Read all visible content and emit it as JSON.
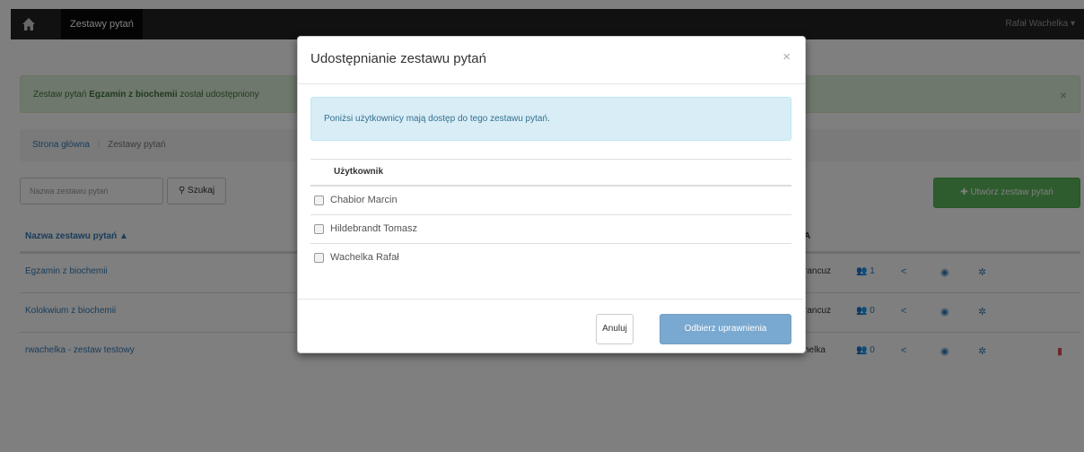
{
  "navbar": {
    "brand": "Zestawy pytań",
    "user": "Rafał Wachelka"
  },
  "alert": {
    "prefix": "Zestaw pytań",
    "name": "Egzamin z biochemii",
    "suffix": "został udostępniony",
    "close": "×"
  },
  "breadcrumb": {
    "home": "Strona główna",
    "current": "Zestawy pytań"
  },
  "search": {
    "placeholder": "Nazwa zestawu pytań",
    "button": "Szukaj"
  },
  "create_button": "Utwórz zestaw pytań",
  "table": {
    "col_name": "Nazwa zestawu pytań ▲",
    "col_right": "A",
    "rows": [
      {
        "name": "Egzamin z biochemii",
        "author": "rancuz",
        "users": "1"
      },
      {
        "name": "Kolokwium z biochemii",
        "author": "rancuz",
        "users": "0"
      },
      {
        "name": "rwachelka - zestaw testowy",
        "author": "helka",
        "users": "0"
      }
    ]
  },
  "modal": {
    "title": "Udostępnianie zestawu pytań",
    "close": "×",
    "info": "Poniżsi użytkownicy mają dostęp do tego zestawu pytań.",
    "column": "Użytkownik",
    "users": [
      "Chabior Marcin",
      "Hildebrandt Tomasz",
      "Wachelka Rafał"
    ],
    "cancel": "Anuluj",
    "revoke": "Odbierz uprawnienia"
  }
}
